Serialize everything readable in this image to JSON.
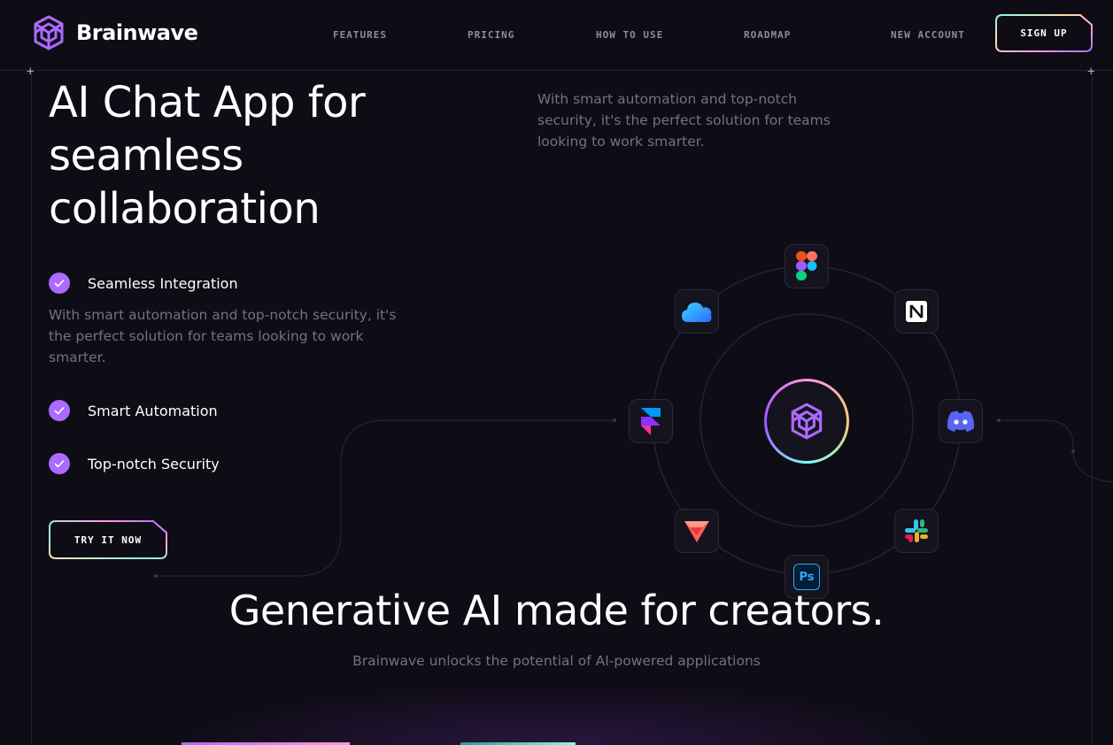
{
  "header": {
    "brand": "Brainwave",
    "nav": [
      {
        "label": "FEATURES"
      },
      {
        "label": "PRICING"
      },
      {
        "label": "HOW TO USE"
      },
      {
        "label": "ROADMAP"
      },
      {
        "label": "NEW ACCOUNT"
      }
    ],
    "signup_label": "SIGN UP"
  },
  "hero": {
    "title": "AI Chat App for seamless collaboration",
    "right_description": "With smart automation and top-notch security, it's the perfect solution for teams looking to work smarter.",
    "features": [
      {
        "label": "Seamless Integration",
        "description": "With smart automation and top-notch security, it's the perfect solution for teams looking to work smarter."
      },
      {
        "label": "Smart Automation"
      },
      {
        "label": "Top-notch Security"
      }
    ],
    "cta_label": "TRY IT NOW"
  },
  "apps": [
    {
      "icon": "figma-icon"
    },
    {
      "icon": "notion-icon"
    },
    {
      "icon": "discord-icon"
    },
    {
      "icon": "slack-icon"
    },
    {
      "icon": "photoshop-icon",
      "text": "Ps"
    },
    {
      "icon": "protopie-icon"
    },
    {
      "icon": "framer-icon"
    },
    {
      "icon": "cloud-icon"
    }
  ],
  "section2": {
    "title": "Generative AI made for creators.",
    "subtitle": "Brainwave unlocks the potential of AI-powered applications"
  },
  "colors": {
    "background": "#0e0c15",
    "accent": "#ac6aff",
    "muted_text": "#757185",
    "stroke": "#252134"
  }
}
